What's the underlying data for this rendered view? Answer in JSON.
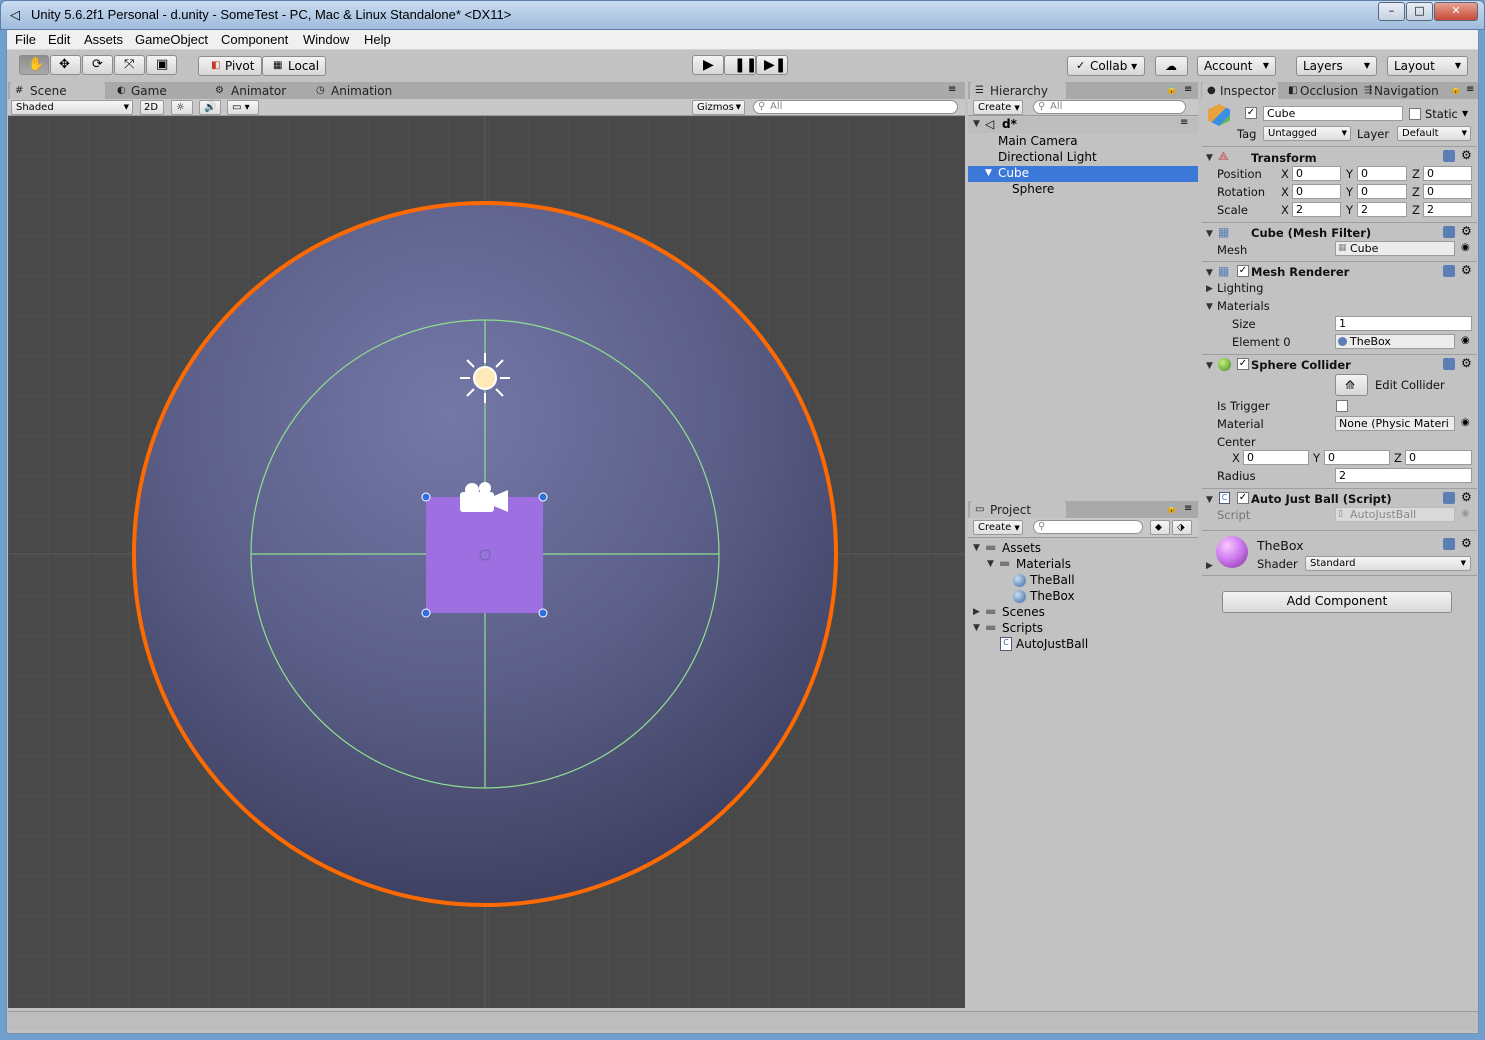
{
  "window": {
    "title": "Unity 5.6.2f1 Personal - d.unity - SomeTest - PC, Mac & Linux Standalone* <DX11>",
    "min": "–",
    "max": "□",
    "close": "✕"
  },
  "menu": [
    "File",
    "Edit",
    "Assets",
    "GameObject",
    "Component",
    "Window",
    "Help"
  ],
  "toolbar": {
    "pivot": "Pivot",
    "local": "Local",
    "collab": "Collab ▾",
    "account": "Account",
    "layers": "Layers",
    "layout": "Layout"
  },
  "scene_tabs": [
    "Scene",
    "Game",
    "Animator",
    "Animation"
  ],
  "scene_bar": {
    "shading": "Shaded",
    "mode2d": "2D",
    "gizmos": "Gizmos",
    "search_placeholder": "All"
  },
  "hierarchy": {
    "tab": "Hierarchy",
    "create": "Create",
    "search_placeholder": "All",
    "scene": "d*",
    "items": [
      {
        "label": "Main Camera"
      },
      {
        "label": "Directional Light"
      },
      {
        "label": "Cube"
      },
      {
        "label": "Sphere"
      }
    ]
  },
  "project": {
    "tab": "Project",
    "create": "Create",
    "items": [
      {
        "label": "Assets"
      },
      {
        "label": "Materials"
      },
      {
        "label": "TheBall"
      },
      {
        "label": "TheBox"
      },
      {
        "label": "Scenes"
      },
      {
        "label": "Scripts"
      },
      {
        "label": "AutoJustBall"
      }
    ]
  },
  "inspector": {
    "tabs": [
      "Inspector",
      "Occlusion",
      "Navigation"
    ],
    "object_name": "Cube",
    "static_label": "Static",
    "tag_label": "Tag",
    "tag_value": "Untagged",
    "layer_label": "Layer",
    "layer_value": "Default",
    "transform": {
      "title": "Transform",
      "rows": [
        {
          "label": "Position",
          "x": "0",
          "y": "0",
          "z": "0"
        },
        {
          "label": "Rotation",
          "x": "0",
          "y": "0",
          "z": "0"
        },
        {
          "label": "Scale",
          "x": "2",
          "y": "2",
          "z": "2"
        }
      ]
    },
    "mesh_filter": {
      "title": "Cube (Mesh Filter)",
      "mesh_label": "Mesh",
      "mesh_value": "Cube"
    },
    "mesh_renderer": {
      "title": "Mesh Renderer",
      "lighting": "Lighting",
      "materials": "Materials",
      "size_label": "Size",
      "size_value": "1",
      "element_label": "Element 0",
      "element_value": "TheBox"
    },
    "sphere_collider": {
      "title": "Sphere Collider",
      "edit": "Edit Collider",
      "trigger_label": "Is Trigger",
      "material_label": "Material",
      "material_value": "None (Physic Materi",
      "center_label": "Center",
      "cx": "0",
      "cy": "0",
      "cz": "0",
      "radius_label": "Radius",
      "radius_value": "2"
    },
    "script": {
      "title": "Auto Just Ball (Script)",
      "label": "Script",
      "value": "AutoJustBall"
    },
    "material": {
      "name": "TheBox",
      "shader_label": "Shader",
      "shader_value": "Standard"
    },
    "add_component": "Add Component",
    "axes": {
      "x": "X",
      "y": "Y",
      "z": "Z"
    }
  },
  "colors": {
    "selection": "#3c78d8",
    "collider_outline": "#ff6a00",
    "sphere": "#6a6e9e",
    "cube": "#9d6fe0",
    "gizmo": "#8fe08f"
  }
}
